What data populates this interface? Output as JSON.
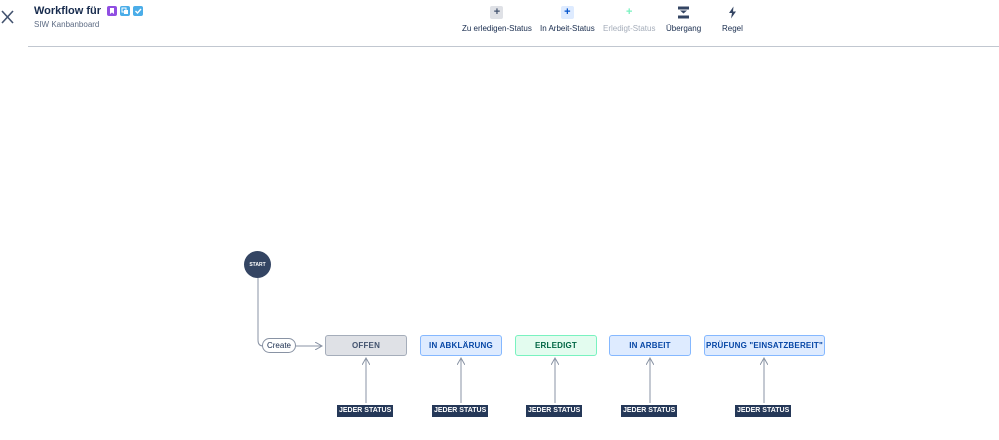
{
  "header": {
    "title": "Workflow für",
    "subtitle": "SIW Kanbanboard",
    "title_icons": [
      {
        "name": "story-icon",
        "color": "#904ee2"
      },
      {
        "name": "subtask-icon",
        "color": "#4bade8"
      },
      {
        "name": "task-icon",
        "color": "#4bade8"
      }
    ]
  },
  "toolbar": {
    "todo_status": "Zu erledigen-Status",
    "inprogress_status": "In Arbeit-Status",
    "done_status": "Erledigt-Status",
    "transition": "Übergang",
    "rule": "Regel"
  },
  "diagram": {
    "start_label": "START",
    "create_transition": "Create",
    "statuses": [
      {
        "label": "OFFEN",
        "category": "todo"
      },
      {
        "label": "IN ABKLÄRUNG",
        "category": "inprogress"
      },
      {
        "label": "ERLEDIGT",
        "category": "done"
      },
      {
        "label": "IN ARBEIT",
        "category": "inprogress"
      },
      {
        "label": "PRÜFUNG \"EINSATZBEREIT\"",
        "category": "inprogress"
      }
    ],
    "any_status_label": "JEDER STATUS"
  },
  "colors": {
    "todo": "#dfe1e6",
    "inprogress": "#deebff",
    "done": "#e3fcef",
    "dark": "#253858"
  }
}
